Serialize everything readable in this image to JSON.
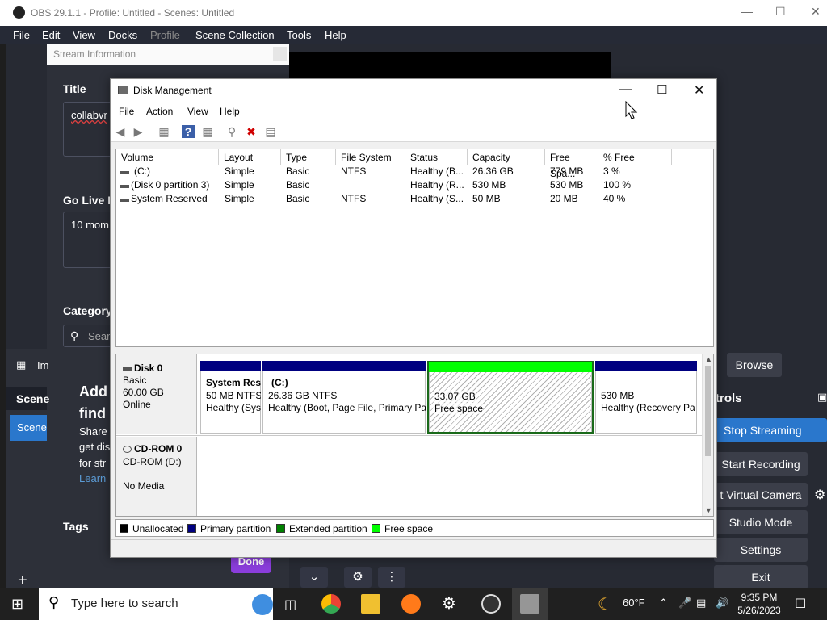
{
  "obs": {
    "title": "OBS 29.1.1 - Profile: Untitled - Scenes: Untitled",
    "menu": [
      "File",
      "Edit",
      "View",
      "Docks",
      "Profile",
      "Scene Collection",
      "Tools",
      "Help"
    ],
    "stream_info_title": "Stream Information",
    "title_label": "Title",
    "title_value": "collabvr",
    "go_live_label": "Go Live N",
    "go_live_value": "10 mom",
    "category_label": "Category",
    "search_placeholder": "Sear",
    "tags_label": "Tags",
    "done_label": "Done",
    "add_heading_1": "Add",
    "add_heading_2": "find",
    "share_lines": [
      "Share",
      "get dis",
      "for str"
    ],
    "learn_link": "Learn",
    "image_item": "Im",
    "scenes_label": "Scene",
    "scene_item": "Scene",
    "browse_label": "Browse",
    "controls_label": "trols",
    "controls": [
      "Stop Streaming",
      "Start Recording",
      "t Virtual Camera",
      "Studio Mode",
      "Settings",
      "Exit"
    ]
  },
  "dm": {
    "title": "Disk Management",
    "menu": [
      "File",
      "Action",
      "View",
      "Help"
    ],
    "columns": [
      "Volume",
      "Layout",
      "Type",
      "File System",
      "Status",
      "Capacity",
      "Free Spa...",
      "% Free"
    ],
    "rows": [
      [
        "(C:)",
        "Simple",
        "Basic",
        "NTFS",
        "Healthy (B...",
        "26.36 GB",
        "779 MB",
        "3 %"
      ],
      [
        "(Disk 0 partition 3)",
        "Simple",
        "Basic",
        "",
        "Healthy (R...",
        "530 MB",
        "530 MB",
        "100 %"
      ],
      [
        "System Reserved",
        "Simple",
        "Basic",
        "NTFS",
        "Healthy (S...",
        "50 MB",
        "20 MB",
        "40 %"
      ]
    ],
    "disk0": {
      "name": "Disk 0",
      "type": "Basic",
      "size": "60.00 GB",
      "status": "Online",
      "partitions": [
        {
          "name": "System Res",
          "line2": "50 MB NTFS",
          "line3": "Healthy (Sys"
        },
        {
          "name": "(C:)",
          "line2": "26.36 GB NTFS",
          "line3": "Healthy (Boot, Page File, Primary Pa"
        },
        {
          "name": "",
          "line2": "33.07 GB",
          "line3": "Free space"
        },
        {
          "name": "",
          "line2": "530 MB",
          "line3": "Healthy (Recovery Pa"
        }
      ]
    },
    "cdrom": {
      "name": "CD-ROM 0",
      "drive": "CD-ROM (D:)",
      "media": "No Media"
    },
    "legend": [
      "Unallocated",
      "Primary partition",
      "Extended partition",
      "Free space"
    ],
    "colors": {
      "primary": "#000080",
      "free": "#00ff00",
      "extended": "#008000",
      "unallocated": "#000000"
    }
  },
  "taskbar": {
    "search_placeholder": "Type here to search",
    "weather": "60°F",
    "time": "9:35 PM",
    "date": "5/26/2023"
  }
}
